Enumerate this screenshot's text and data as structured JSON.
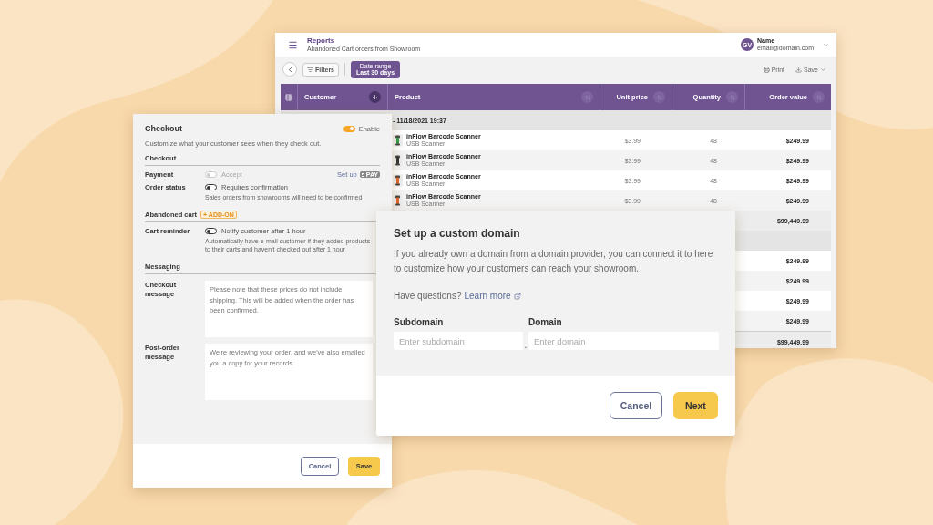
{
  "report": {
    "title": "Reports",
    "subtitle": "Abandoned Cart orders from Showroom",
    "user": {
      "initials": "GV",
      "name": "Name",
      "email": "email@domain.com"
    },
    "toolbar": {
      "filters": "Filters",
      "date_range_label": "Date range",
      "date_range_value": "Last 30 days",
      "print": "Print",
      "save": "Save"
    },
    "columns": [
      {
        "label": "Customer",
        "sorted": true
      },
      {
        "label": "Product",
        "sorted": false
      },
      {
        "label": "Unit price",
        "sorted": false
      },
      {
        "label": "Quantity",
        "sorted": false
      },
      {
        "label": "Order value",
        "sorted": false
      }
    ],
    "groups": [
      {
        "header": "- 11/18/2021 19:37",
        "rows": [
          {
            "product": "inFlow Barcode Scanner",
            "variant": "USB Scanner",
            "unit_price": "$3.99",
            "quantity": "48",
            "order_value": "$249.99"
          },
          {
            "product": "inFlow Barcode Scanner",
            "variant": "USB Scanner",
            "unit_price": "$3.99",
            "quantity": "48",
            "order_value": "$249.99"
          },
          {
            "product": "inFlow Barcode Scanner",
            "variant": "USB Scanner",
            "unit_price": "$3.99",
            "quantity": "48",
            "order_value": "$249.99"
          },
          {
            "product": "inFlow Barcode Scanner",
            "variant": "USB Scanner",
            "unit_price": "$3.99",
            "quantity": "48",
            "order_value": "$249.99"
          }
        ],
        "subtotal": "$99,449.99"
      },
      {
        "rows": [
          {
            "order_value": "$249.99"
          },
          {
            "order_value": "$249.99"
          },
          {
            "order_value": "$249.99"
          },
          {
            "order_value": "$249.99"
          }
        ],
        "subtotal": "$99,449.99"
      }
    ]
  },
  "checkout": {
    "title": "Checkout",
    "enable": {
      "label": "Enable",
      "on": true
    },
    "description": "Customize what your customer sees when they check out.",
    "sections": [
      {
        "heading": "Checkout",
        "settings": [
          {
            "label": "Payment",
            "toggle_label": "Accept",
            "on": false,
            "disabled": true,
            "action": "Set up",
            "badge": "PAY"
          },
          {
            "label": "Order status",
            "toggle_label": "Requires confirmation",
            "on": false,
            "disabled": false,
            "help": "Sales orders from showrooms will need to be confirmed"
          }
        ]
      },
      {
        "heading": "Abandoned cart",
        "tag": "+ ADD-ON",
        "settings": [
          {
            "label": "Cart reminder",
            "toggle_label": "Notify customer after 1 hour",
            "on": false,
            "disabled": false,
            "help": "Automatically have e-mail customer if they added products to their carts and haven't checked out after 1 hour"
          }
        ]
      },
      {
        "heading": "Messaging",
        "messages": [
          {
            "label": "Checkout message",
            "value": "Please note that these prices do not include shipping. This will be added when the order has been confirmed."
          },
          {
            "label": "Post-order message",
            "value": "We're reviewing your order, and we've also emailed you a copy for your records."
          }
        ]
      }
    ],
    "buttons": {
      "cancel": "Cancel",
      "save": "Save"
    }
  },
  "domain_dialog": {
    "title": "Set up a custom domain",
    "description": "If you already own a domain from a domain provider, you can connect it to here to customize how your customers can reach your showroom.",
    "question": "Have questions?",
    "link": "Learn more",
    "fields": [
      {
        "label": "Subdomain",
        "placeholder": "Enter subdomain"
      },
      {
        "label": "Domain",
        "placeholder": "Enter domain"
      }
    ],
    "separator": ".",
    "buttons": {
      "cancel": "Cancel",
      "next": "Next"
    }
  }
}
